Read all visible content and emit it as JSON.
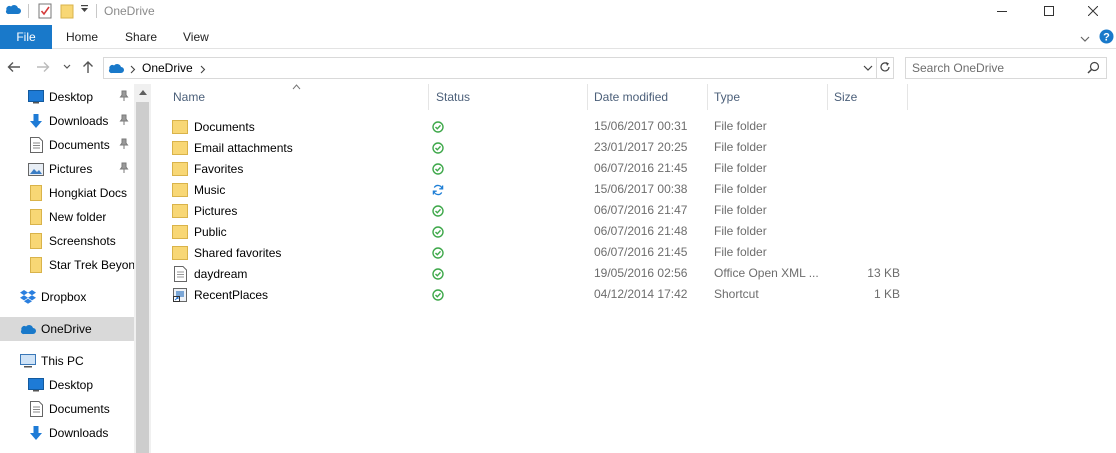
{
  "window": {
    "title": "OneDrive"
  },
  "ribbon": {
    "file_label": "File",
    "tabs": [
      {
        "label": "Home"
      },
      {
        "label": "Share"
      },
      {
        "label": "View"
      }
    ]
  },
  "address": {
    "location": "OneDrive"
  },
  "search": {
    "placeholder": "Search OneDrive"
  },
  "navpane": {
    "quick_access": [
      {
        "label": "Desktop",
        "icon": "desktop-icon",
        "pinned": true
      },
      {
        "label": "Downloads",
        "icon": "download-arrow-icon",
        "pinned": true
      },
      {
        "label": "Documents",
        "icon": "document-icon",
        "pinned": true
      },
      {
        "label": "Pictures",
        "icon": "pictures-icon",
        "pinned": true
      },
      {
        "label": "Hongkiat Docs",
        "icon": "folder-icon",
        "pinned": false
      },
      {
        "label": "New folder",
        "icon": "folder-icon",
        "pinned": false
      },
      {
        "label": "Screenshots",
        "icon": "folder-icon",
        "pinned": false
      },
      {
        "label": "Star Trek Beyond",
        "icon": "folder-icon",
        "pinned": false
      }
    ],
    "dropbox": "Dropbox",
    "onedrive": "OneDrive",
    "this_pc": "This PC",
    "this_pc_children": [
      {
        "label": "Desktop",
        "icon": "desktop-icon"
      },
      {
        "label": "Documents",
        "icon": "document-icon"
      },
      {
        "label": "Downloads",
        "icon": "download-arrow-icon"
      }
    ]
  },
  "columns": {
    "name": "Name",
    "status": "Status",
    "date": "Date modified",
    "type": "Type",
    "size": "Size"
  },
  "files": [
    {
      "name": "Documents",
      "icon": "folder-icon",
      "status": "synced",
      "date": "15/06/2017 00:31",
      "type": "File folder",
      "size": ""
    },
    {
      "name": "Email attachments",
      "icon": "folder-icon",
      "status": "synced",
      "date": "23/01/2017 20:25",
      "type": "File folder",
      "size": ""
    },
    {
      "name": "Favorites",
      "icon": "folder-icon",
      "status": "synced",
      "date": "06/07/2016 21:45",
      "type": "File folder",
      "size": ""
    },
    {
      "name": "Music",
      "icon": "folder-icon",
      "status": "syncing",
      "date": "15/06/2017 00:38",
      "type": "File folder",
      "size": ""
    },
    {
      "name": "Pictures",
      "icon": "folder-icon",
      "status": "synced",
      "date": "06/07/2016 21:47",
      "type": "File folder",
      "size": ""
    },
    {
      "name": "Public",
      "icon": "folder-icon",
      "status": "synced",
      "date": "06/07/2016 21:48",
      "type": "File folder",
      "size": ""
    },
    {
      "name": "Shared favorites",
      "icon": "folder-icon",
      "status": "synced",
      "date": "06/07/2016 21:45",
      "type": "File folder",
      "size": ""
    },
    {
      "name": "daydream",
      "icon": "document-icon",
      "status": "synced",
      "date": "19/05/2016 02:56",
      "type": "Office Open XML ...",
      "size": "13 KB"
    },
    {
      "name": "RecentPlaces",
      "icon": "shortcut-icon",
      "status": "synced",
      "date": "04/12/2014 17:42",
      "type": "Shortcut",
      "size": "1 KB"
    }
  ],
  "colors": {
    "accent": "#1979ca",
    "folder": "#f8d775",
    "synced": "#3ea84a",
    "syncing": "#1f7fd6",
    "selected_bg": "#d9d9d9"
  }
}
